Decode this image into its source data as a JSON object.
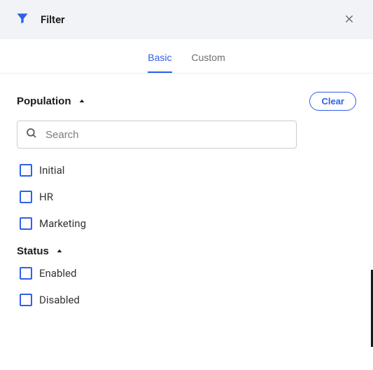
{
  "header": {
    "title": "Filter"
  },
  "tabs": {
    "basic": "Basic",
    "custom": "Custom"
  },
  "actions": {
    "clear": "Clear"
  },
  "sections": {
    "population": {
      "title": "Population",
      "search_placeholder": "Search",
      "items": [
        "Initial",
        "HR",
        "Marketing"
      ]
    },
    "status": {
      "title": "Status",
      "items": [
        "Enabled",
        "Disabled"
      ]
    }
  },
  "colors": {
    "accent": "#2f5fea"
  }
}
